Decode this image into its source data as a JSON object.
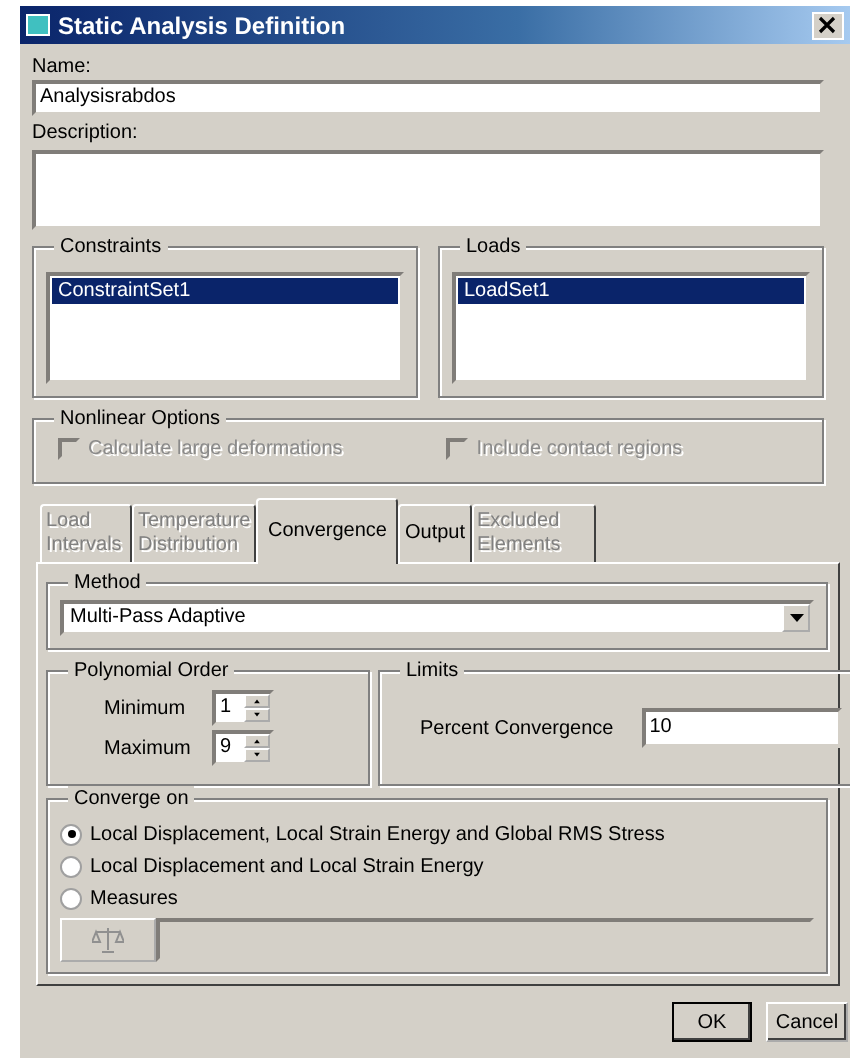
{
  "window": {
    "title": "Static Analysis Definition"
  },
  "name_field": {
    "label": "Name:",
    "value": "Analysisrabdos"
  },
  "description_field": {
    "label": "Description:"
  },
  "constraints": {
    "title": "Constraints",
    "items": [
      {
        "label": "ConstraintSet1",
        "selected": true
      }
    ]
  },
  "loads": {
    "title": "Loads",
    "items": [
      {
        "label": "LoadSet1",
        "selected": true
      }
    ]
  },
  "nonlinear_options": {
    "title": "Nonlinear Options",
    "options": [
      {
        "label": "Calculate large deformations",
        "checked": false,
        "disabled": true
      },
      {
        "label": "Include contact regions",
        "checked": false,
        "disabled": true
      }
    ]
  },
  "tabs": [
    {
      "label": "Load Intervals",
      "selected": false,
      "disabled": true
    },
    {
      "label": "Temperature Distribution",
      "selected": false,
      "disabled": true
    },
    {
      "label": "Convergence",
      "selected": true,
      "disabled": false
    },
    {
      "label": "Output",
      "selected": false,
      "disabled": false
    },
    {
      "label": "Excluded Elements",
      "selected": false,
      "disabled": true
    }
  ],
  "method": {
    "title": "Method",
    "value": "Multi-Pass Adaptive"
  },
  "polynomial_order": {
    "title": "Polynomial Order",
    "fields": [
      {
        "label": "Minimum",
        "value": "1"
      },
      {
        "label": "Maximum",
        "value": "9"
      }
    ]
  },
  "limits": {
    "title": "Limits",
    "label": "Percent Convergence",
    "value": "10"
  },
  "converge_on": {
    "title": "Converge on",
    "options": [
      {
        "label": "Local Displacement, Local Strain Energy and Global RMS Stress",
        "selected": true
      },
      {
        "label": "Local Displacement and Local Strain Energy",
        "selected": false
      },
      {
        "label": "Measures",
        "selected": false
      }
    ]
  },
  "buttons": [
    "OK",
    "Cancel"
  ]
}
